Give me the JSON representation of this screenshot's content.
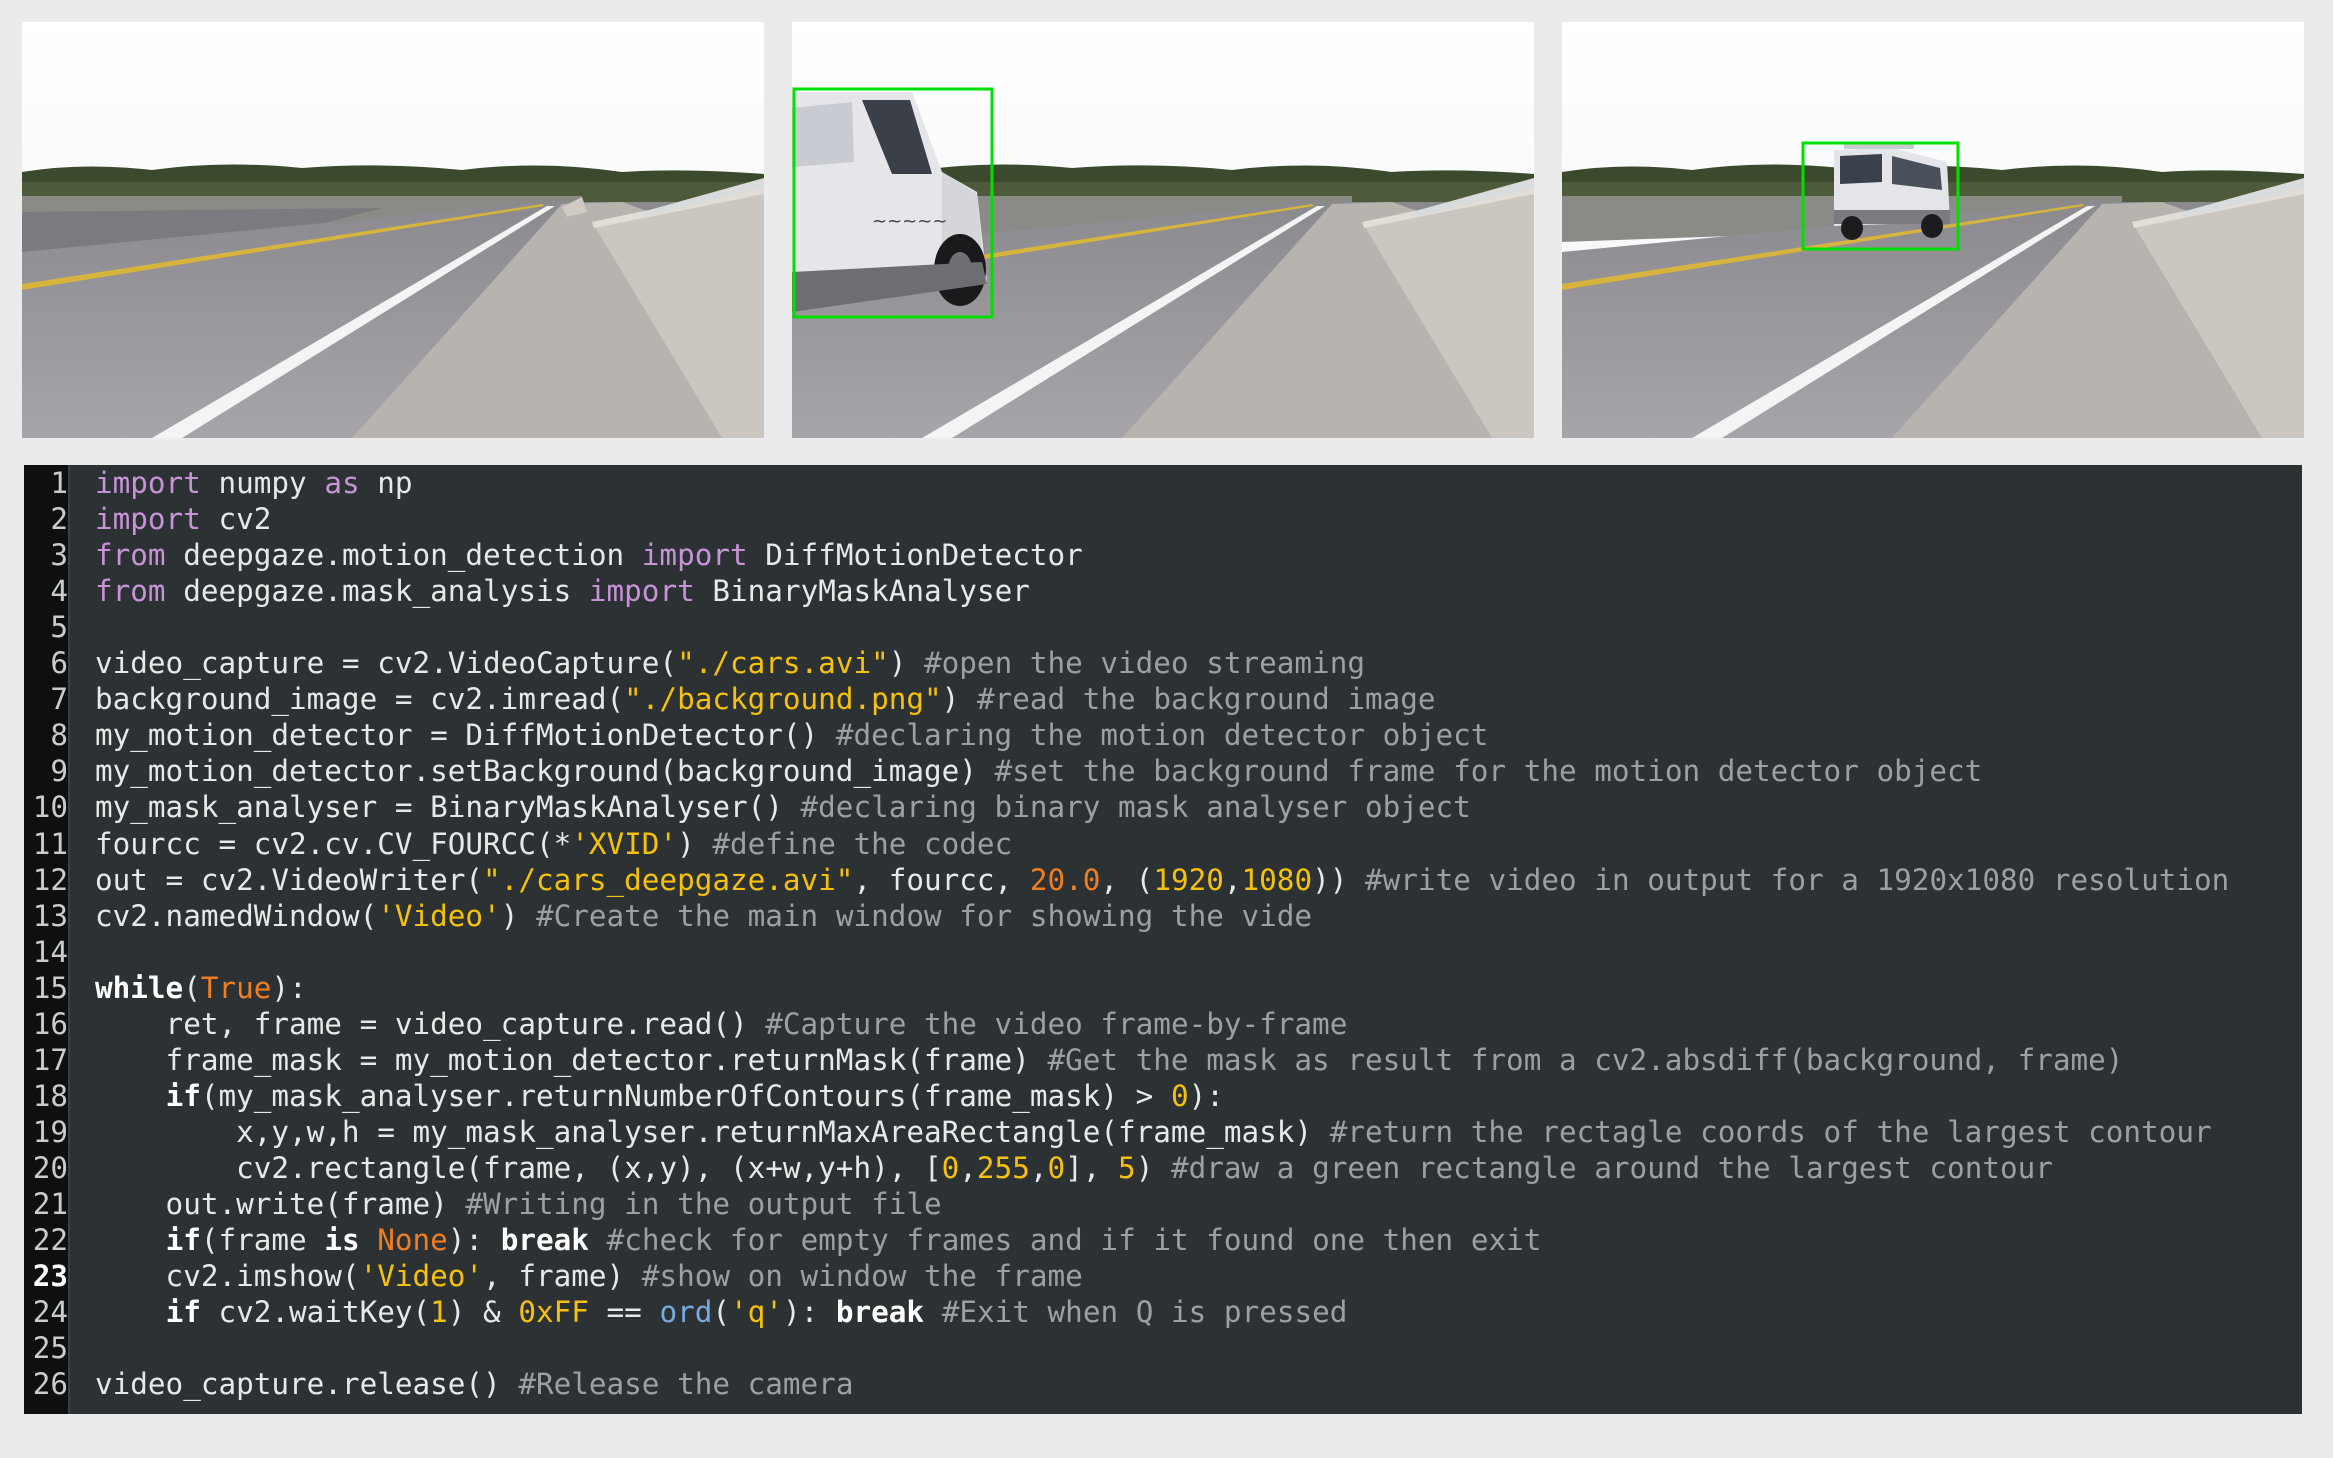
{
  "frames": [
    {
      "name": "empty road frame",
      "detection": null
    },
    {
      "name": "van entering frame",
      "detection": "near-left"
    },
    {
      "name": "van in distance frame",
      "detection": "far-center"
    }
  ],
  "colors": {
    "code_background": "#2c3134",
    "gutter_background": "#0d0f10",
    "keyword": "#c793d6",
    "string": "#f5c10c",
    "number": "#f07e20",
    "builtin": "#79a9e0",
    "comment": "#9aa0a4",
    "text": "#e6e8e9",
    "detection_box": "#00e000"
  },
  "code": {
    "lines": [
      {
        "n": "1",
        "tokens": [
          {
            "t": "import",
            "k": "kw"
          },
          {
            "t": " numpy ",
            "k": "txt"
          },
          {
            "t": "as",
            "k": "kw"
          },
          {
            "t": " np",
            "k": "txt"
          }
        ]
      },
      {
        "n": "2",
        "tokens": [
          {
            "t": "import",
            "k": "kw"
          },
          {
            "t": " cv2",
            "k": "txt"
          }
        ]
      },
      {
        "n": "3",
        "tokens": [
          {
            "t": "from",
            "k": "kw"
          },
          {
            "t": " deepgaze.motion_detection ",
            "k": "txt"
          },
          {
            "t": "import",
            "k": "kw"
          },
          {
            "t": " DiffMotionDetector",
            "k": "txt"
          }
        ]
      },
      {
        "n": "4",
        "tokens": [
          {
            "t": "from",
            "k": "kw"
          },
          {
            "t": " deepgaze.mask_analysis ",
            "k": "txt"
          },
          {
            "t": "import",
            "k": "kw"
          },
          {
            "t": " BinaryMaskAnalyser",
            "k": "txt"
          }
        ]
      },
      {
        "n": "5",
        "tokens": []
      },
      {
        "n": "6",
        "tokens": [
          {
            "t": "video_capture = cv2.VideoCapture(",
            "k": "txt"
          },
          {
            "t": "\"./cars.avi\"",
            "k": "str"
          },
          {
            "t": ") ",
            "k": "txt"
          },
          {
            "t": "#open the video streaming",
            "k": "com"
          }
        ]
      },
      {
        "n": "7",
        "tokens": [
          {
            "t": "background_image = cv2.imread(",
            "k": "txt"
          },
          {
            "t": "\"./background.png\"",
            "k": "str"
          },
          {
            "t": ") ",
            "k": "txt"
          },
          {
            "t": "#read the background image",
            "k": "com"
          }
        ]
      },
      {
        "n": "8",
        "tokens": [
          {
            "t": "my_motion_detector = DiffMotionDetector() ",
            "k": "txt"
          },
          {
            "t": "#declaring the motion detector object",
            "k": "com"
          }
        ]
      },
      {
        "n": "9",
        "tokens": [
          {
            "t": "my_motion_detector.setBackground(background_image) ",
            "k": "txt"
          },
          {
            "t": "#set the background frame for the motion detector object",
            "k": "com"
          }
        ]
      },
      {
        "n": "10",
        "tokens": [
          {
            "t": "my_mask_analyser = BinaryMaskAnalyser() ",
            "k": "txt"
          },
          {
            "t": "#declaring binary mask analyser object",
            "k": "com"
          }
        ]
      },
      {
        "n": "11",
        "tokens": [
          {
            "t": "fourcc = cv2.cv.CV_FOURCC(*",
            "k": "txt"
          },
          {
            "t": "'XVID'",
            "k": "str"
          },
          {
            "t": ") ",
            "k": "txt"
          },
          {
            "t": "#define the codec",
            "k": "com"
          }
        ]
      },
      {
        "n": "12",
        "tokens": [
          {
            "t": "out = cv2.VideoWriter(",
            "k": "txt"
          },
          {
            "t": "\"./cars_deepgaze.avi\"",
            "k": "str"
          },
          {
            "t": ", fourcc, ",
            "k": "txt"
          },
          {
            "t": "20.0",
            "k": "num"
          },
          {
            "t": ", (",
            "k": "txt"
          },
          {
            "t": "1920",
            "k": "numy"
          },
          {
            "t": ",",
            "k": "txt"
          },
          {
            "t": "1080",
            "k": "numy"
          },
          {
            "t": ")) ",
            "k": "txt"
          },
          {
            "t": "#write video in output for a 1920x1080 resolution",
            "k": "com"
          }
        ]
      },
      {
        "n": "13",
        "tokens": [
          {
            "t": "cv2.namedWindow(",
            "k": "txt"
          },
          {
            "t": "'Video'",
            "k": "str"
          },
          {
            "t": ") ",
            "k": "txt"
          },
          {
            "t": "#Create the main window for showing the vide",
            "k": "com"
          }
        ]
      },
      {
        "n": "14",
        "tokens": []
      },
      {
        "n": "15",
        "tokens": [
          {
            "t": "while",
            "k": "bold"
          },
          {
            "t": "(",
            "k": "txt"
          },
          {
            "t": "True",
            "k": "num"
          },
          {
            "t": "):",
            "k": "txt"
          }
        ]
      },
      {
        "n": "16",
        "tokens": [
          {
            "t": "    ret, frame = video_capture.read() ",
            "k": "txt"
          },
          {
            "t": "#Capture the video frame-by-frame",
            "k": "com"
          }
        ]
      },
      {
        "n": "17",
        "tokens": [
          {
            "t": "    frame_mask = my_motion_detector.returnMask(frame) ",
            "k": "txt"
          },
          {
            "t": "#Get the mask as result from a cv2.absdiff(background, frame)",
            "k": "com"
          }
        ]
      },
      {
        "n": "18",
        "tokens": [
          {
            "t": "    ",
            "k": "txt"
          },
          {
            "t": "if",
            "k": "bold"
          },
          {
            "t": "(my_mask_analyser.returnNumberOfContours(frame_mask) > ",
            "k": "txt"
          },
          {
            "t": "0",
            "k": "numy"
          },
          {
            "t": "):",
            "k": "txt"
          }
        ]
      },
      {
        "n": "19",
        "tokens": [
          {
            "t": "        x,y,w,h = my_mask_analyser.returnMaxAreaRectangle(frame_mask) ",
            "k": "txt"
          },
          {
            "t": "#return the rectagle coords of the largest contour",
            "k": "com"
          }
        ]
      },
      {
        "n": "20",
        "tokens": [
          {
            "t": "        cv2.rectangle(frame, (x,y), (x+w,y+h), [",
            "k": "txt"
          },
          {
            "t": "0",
            "k": "numy"
          },
          {
            "t": ",",
            "k": "txt"
          },
          {
            "t": "255",
            "k": "numy"
          },
          {
            "t": ",",
            "k": "txt"
          },
          {
            "t": "0",
            "k": "numy"
          },
          {
            "t": "], ",
            "k": "txt"
          },
          {
            "t": "5",
            "k": "numy"
          },
          {
            "t": ") ",
            "k": "txt"
          },
          {
            "t": "#draw a green rectangle around the largest contour",
            "k": "com"
          }
        ]
      },
      {
        "n": "21",
        "tokens": [
          {
            "t": "    out.write(frame) ",
            "k": "txt"
          },
          {
            "t": "#Writing in the output file",
            "k": "com"
          }
        ]
      },
      {
        "n": "22",
        "tokens": [
          {
            "t": "    ",
            "k": "txt"
          },
          {
            "t": "if",
            "k": "bold"
          },
          {
            "t": "(frame ",
            "k": "txt"
          },
          {
            "t": "is",
            "k": "bold"
          },
          {
            "t": " ",
            "k": "txt"
          },
          {
            "t": "None",
            "k": "num"
          },
          {
            "t": "): ",
            "k": "txt"
          },
          {
            "t": "break",
            "k": "bold"
          },
          {
            "t": " ",
            "k": "txt"
          },
          {
            "t": "#check for empty frames and if it found one then exit",
            "k": "com"
          }
        ]
      },
      {
        "n": "23",
        "tokens": [
          {
            "t": "    cv2.imshow(",
            "k": "txt"
          },
          {
            "t": "'Video'",
            "k": "str"
          },
          {
            "t": ", frame) ",
            "k": "txt"
          },
          {
            "t": "#show on window the frame",
            "k": "com"
          }
        ]
      },
      {
        "n": "24",
        "tokens": [
          {
            "t": "    ",
            "k": "txt"
          },
          {
            "t": "if",
            "k": "bold"
          },
          {
            "t": " cv2.waitKey(",
            "k": "txt"
          },
          {
            "t": "1",
            "k": "numy"
          },
          {
            "t": ") & ",
            "k": "txt"
          },
          {
            "t": "0xFF",
            "k": "numy"
          },
          {
            "t": " == ",
            "k": "txt"
          },
          {
            "t": "ord",
            "k": "bi"
          },
          {
            "t": "(",
            "k": "txt"
          },
          {
            "t": "'q'",
            "k": "str"
          },
          {
            "t": "): ",
            "k": "txt"
          },
          {
            "t": "break",
            "k": "bold"
          },
          {
            "t": " ",
            "k": "txt"
          },
          {
            "t": "#Exit when Q is pressed",
            "k": "com"
          }
        ]
      },
      {
        "n": "25",
        "tokens": []
      },
      {
        "n": "26",
        "tokens": [
          {
            "t": "video_capture.release() ",
            "k": "txt"
          },
          {
            "t": "#Release the camera",
            "k": "com"
          }
        ]
      }
    ],
    "current_line": "23"
  }
}
